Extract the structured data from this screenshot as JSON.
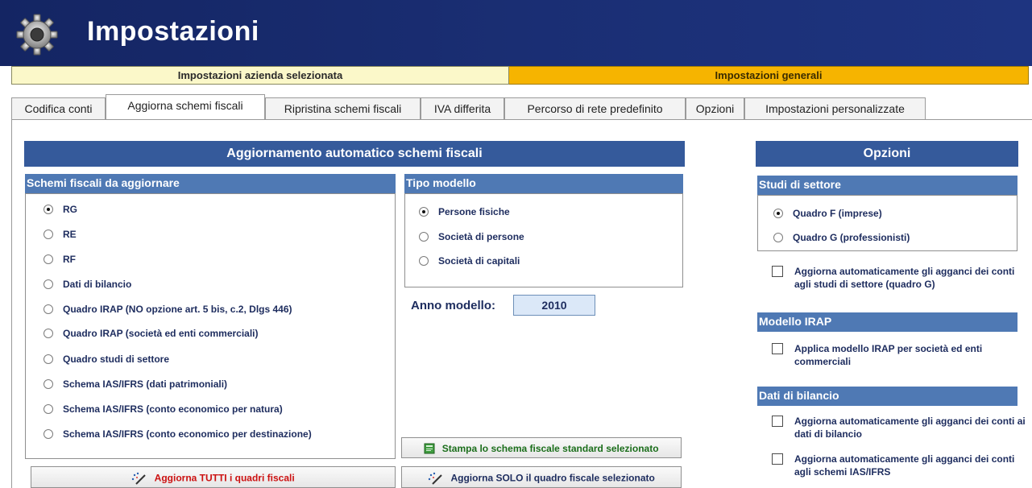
{
  "window": {
    "title": "Impostazioni",
    "icon": "gear-icon"
  },
  "modebar": {
    "company_settings": "Impostazioni azienda selezionata",
    "general_settings": "Impostazioni generali"
  },
  "tabs": [
    {
      "label": "Codifica conti"
    },
    {
      "label": "Aggiorna schemi fiscali",
      "active": true
    },
    {
      "label": "Ripristina schemi fiscali"
    },
    {
      "label": "IVA differita"
    },
    {
      "label": "Percorso di rete predefinito"
    },
    {
      "label": "Opzioni"
    },
    {
      "label": "Impostazioni personalizzate"
    }
  ],
  "main": {
    "banner": "Aggiornamento automatico schemi fiscali",
    "schemi": {
      "header": "Schemi fiscali da aggiornare",
      "items": [
        {
          "label": "RG",
          "selected": true
        },
        {
          "label": "RE",
          "selected": false
        },
        {
          "label": "RF",
          "selected": false
        },
        {
          "label": "Dati di bilancio",
          "selected": false
        },
        {
          "label": "Quadro IRAP (NO opzione art. 5 bis, c.2, Dlgs 446)",
          "selected": false
        },
        {
          "label": "Quadro IRAP (società ed enti commerciali)",
          "selected": false
        },
        {
          "label": "Quadro studi di settore",
          "selected": false
        },
        {
          "label": "Schema IAS/IFRS (dati patrimoniali)",
          "selected": false
        },
        {
          "label": "Schema IAS/IFRS (conto economico per natura)",
          "selected": false
        },
        {
          "label": "Schema IAS/IFRS (conto economico per destinazione)",
          "selected": false
        }
      ]
    },
    "tipo_modello": {
      "header": "Tipo modello",
      "items": [
        {
          "label": "Persone fisiche",
          "selected": true
        },
        {
          "label": "Società di persone",
          "selected": false
        },
        {
          "label": "Società di capitali",
          "selected": false
        }
      ]
    },
    "anno": {
      "label": "Anno modello:",
      "value": "2010"
    },
    "buttons": {
      "print_label": "Stampa lo schema fiscale standard selezionato",
      "update_all_label": "Aggiorna  TUTTI i quadri fiscali",
      "update_selected_label": "Aggiorna  SOLO il quadro fiscale selezionato"
    }
  },
  "options": {
    "banner": "Opzioni",
    "studi": {
      "header": "Studi di settore",
      "radios": [
        {
          "label": "Quadro F (imprese)",
          "selected": true
        },
        {
          "label": "Quadro G (professionisti)",
          "selected": false
        }
      ],
      "check": {
        "label": "Aggiorna automaticamente gli agganci dei conti agli studi di settore (quadro G)",
        "checked": false
      }
    },
    "irap": {
      "header": "Modello IRAP",
      "check": {
        "label": "Applica modello IRAP per società ed enti commerciali",
        "checked": false
      }
    },
    "bilancio": {
      "header": "Dati di bilancio",
      "checks": [
        {
          "label": "Aggiorna automaticamente gli agganci dei conti ai dati di bilancio",
          "checked": false
        },
        {
          "label": "Aggiorna automaticamente gli agganci dei conti agli schemi IAS/IFRS",
          "checked": false
        }
      ]
    }
  },
  "colors": {
    "title_bar": "#142563",
    "banner": "#355a9b",
    "section_header": "#4f79b4",
    "company_bar": "#fbf8c9",
    "general_bar": "#f6b400",
    "update_all_text": "#cc1111",
    "print_text": "#1b6e1b"
  }
}
